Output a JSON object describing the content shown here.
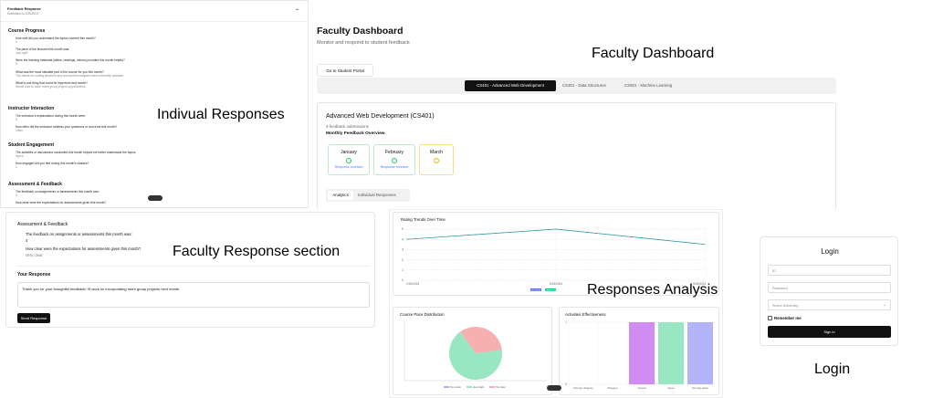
{
  "feedback_response": {
    "title": "Feedback Response",
    "submitted": "Submitted on 1/25/2024",
    "sections": [
      {
        "name": "Course Progress",
        "questions": [
          {
            "q": "How well did you understand the topics covered this month?",
            "a": "4"
          },
          {
            "q": "The pace of the lectures this month was:",
            "a": "Just right"
          },
          {
            "q": "Were the learning materials (slides, readings, videos) provided this month helpful?",
            "a": "5"
          },
          {
            "q": "What was the most valuable part of the course for you this month?",
            "a": "The hands-on coding sessions and real-world examples were extremely valuable."
          },
          {
            "q": "What is one thing that could be improved next month?",
            "a": "Would love to have more group project opportunities."
          }
        ]
      },
      {
        "name": "Instructor Interaction",
        "questions": [
          {
            "q": "The instructor's explanations during this month were:",
            "a": "5"
          },
          {
            "q": "How often did the instructor address your questions or concerns this month?",
            "a": "Often"
          }
        ]
      },
      {
        "name": "Student Engagement",
        "questions": [
          {
            "q": "The activities or discussions conducted this month helped me better understand the topics.",
            "a": "Agree"
          },
          {
            "q": "How engaged did you feel during this month's classes?",
            "a": "4"
          }
        ]
      },
      {
        "name": "Assessment & Feedback",
        "questions": [
          {
            "q": "The feedback on assignments or assessments this month was:",
            "a": "4"
          },
          {
            "q": "How clear were the expectations for assessments given this month?",
            "a": ""
          }
        ]
      }
    ]
  },
  "labels": {
    "individual": "Indivual Responses",
    "dashboard": "Faculty Dashboard",
    "faculty_response": "Faculty Response section",
    "analysis": "Responses Analysis",
    "login": "Login"
  },
  "dashboard": {
    "title": "Faculty Dashboard",
    "subtitle": "Monitor and respond to student feedback",
    "portal_button": "Go to Student Portal",
    "course_tabs": [
      "CS401 - Advanced Web Development",
      "CS301 - Data Structures",
      "CS501 - Machine Learning"
    ],
    "course_title": "Advanced Web Development (CS401)",
    "submissions": "3 feedback submissions",
    "overview_title": "Monthly Feedback Overview",
    "months": [
      {
        "name": "January",
        "status": "Response received",
        "color": "#22c55e"
      },
      {
        "name": "February",
        "status": "Response received",
        "color": "#22c55e"
      },
      {
        "name": "March",
        "status": "",
        "color": "#eab308"
      }
    ],
    "view_tabs": [
      "Analytics",
      "Individual Responses"
    ]
  },
  "faculty_response": {
    "section": "Assessment & Feedback",
    "q1": "The feedback on assignments or assessments this month was:",
    "a1": "4",
    "q2": "How clear were the expectations for assessments given this month?",
    "a2": "Very clear",
    "your_response": "Your Response",
    "response_text": "Thank you for your thoughtful feedback! I'll work on incorporating more group projects next month.",
    "send": "Send Response"
  },
  "analytics": {
    "line_title": "Rating Trends Over Time",
    "pie_title": "Course Pace Distribution",
    "bar_title": "Activities Effectiveness"
  },
  "chart_data": [
    {
      "type": "line",
      "title": "Rating Trends Over Time",
      "x": [
        "1/15/2024",
        "2/15/2024",
        "3/15/2024"
      ],
      "series": [
        {
          "name": "Understanding",
          "values": [
            4,
            5,
            3.5
          ],
          "color": "#4f63d8"
        },
        {
          "name": "Engagement",
          "values": [
            4,
            5,
            3.5
          ],
          "color": "#10b981"
        }
      ],
      "ylim": [
        0,
        5
      ],
      "yticks": [
        0,
        1,
        2,
        3,
        4,
        5
      ],
      "grid": true,
      "legend": "bottom"
    },
    {
      "type": "pie",
      "title": "Course Pace Distribution",
      "slices": [
        {
          "name": "Too slow",
          "value": 0,
          "color": "#a5b4fc"
        },
        {
          "name": "Just right",
          "value": 67,
          "color": "#99e6c2"
        },
        {
          "name": "Too fast",
          "value": 33,
          "color": "#f7b0b0"
        }
      ],
      "legend": "bottom"
    },
    {
      "type": "bar",
      "title": "Activities Effectiveness",
      "categories": [
        "Strongly disagree",
        "Disagree",
        "Neutral",
        "Agree",
        "Strongly agree"
      ],
      "values": [
        0,
        0,
        1,
        1,
        1
      ],
      "colors": [
        "#c4b5fd",
        "#99e6c2",
        "#d08cf0",
        "#99e6c2",
        "#b3b3f7"
      ],
      "ylim": [
        0,
        1
      ],
      "yticks": [
        0,
        1
      ]
    }
  ],
  "login": {
    "title": "Login",
    "id_placeholder": "ID",
    "password_placeholder": "Password",
    "university_placeholder": "Select University",
    "remember": "Remember me",
    "sign_in": "Sign in"
  }
}
